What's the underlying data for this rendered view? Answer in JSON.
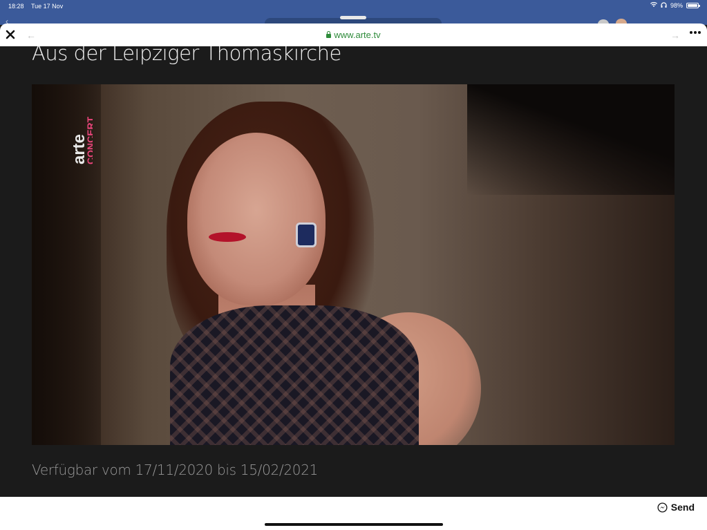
{
  "status_bar": {
    "time": "18:28",
    "date": "Tue 17 Nov",
    "battery_text": "98%",
    "battery_level": 0.98
  },
  "browser": {
    "url": "www.arte.tv",
    "close_icon": "close-icon",
    "back_icon": "arrow-left-icon",
    "forward_icon": "arrow-right-icon",
    "more_icon": "ellipsis-icon"
  },
  "page": {
    "title": "Aus der Leipziger Thomaskirche",
    "availability": "Verfügbar vom 17/11/2020 bis 15/02/2021",
    "video": {
      "logo_top": "arte",
      "logo_bottom": "CONCERT"
    }
  },
  "footer": {
    "send_label": "Send",
    "send_icon": "messenger-icon"
  },
  "colors": {
    "status_bar_bg": "#3b5a9a",
    "page_bg": "#1b1b1b",
    "url_green": "#2e8b3a",
    "arte_pink": "#e8457a"
  }
}
